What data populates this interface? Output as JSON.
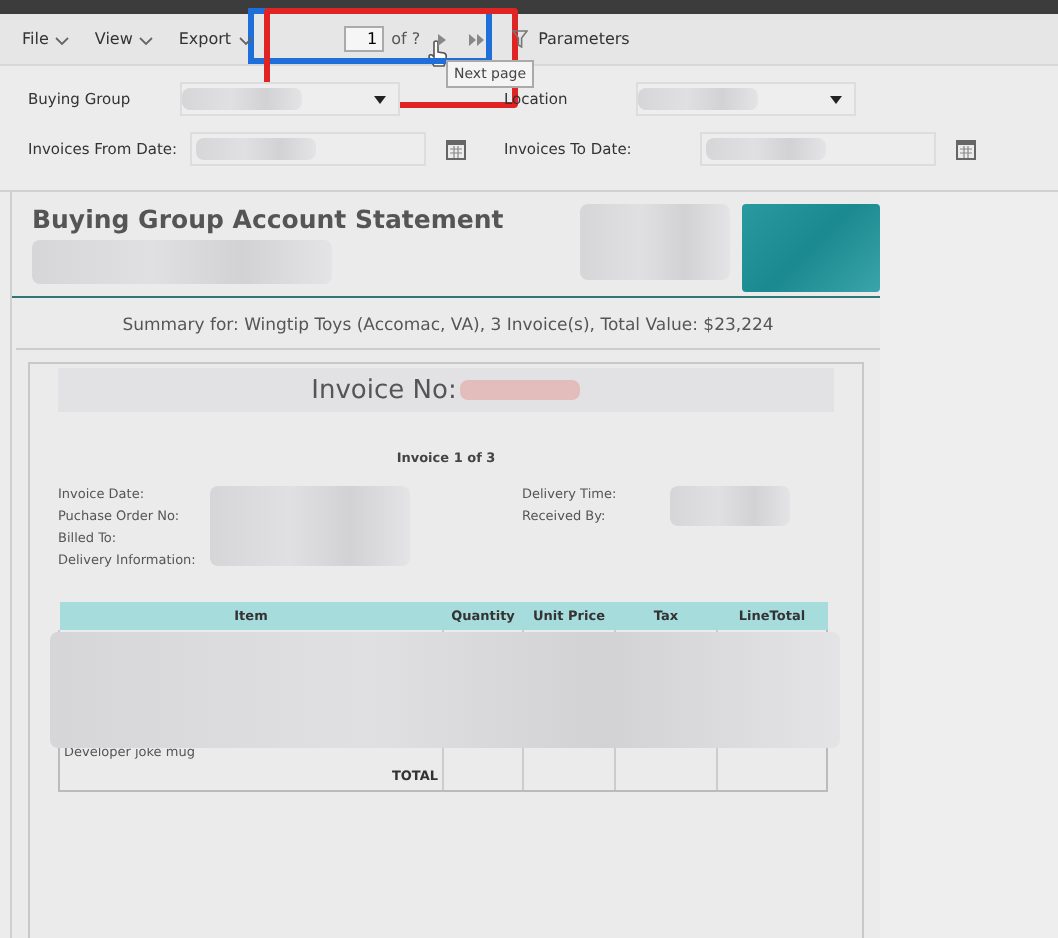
{
  "toolbar": {
    "menus": [
      {
        "label": "File"
      },
      {
        "label": "View"
      },
      {
        "label": "Export"
      }
    ],
    "page_input": {
      "value": "1"
    },
    "page_count": "of ?",
    "tooltip": "Next page",
    "parameters_label": "Parameters"
  },
  "parameters": [
    {
      "label": "Buying Group",
      "kind": "dropdown"
    },
    {
      "label": "Location",
      "kind": "dropdown"
    },
    {
      "label": "Invoices From Date:",
      "kind": "date"
    },
    {
      "label": "Invoices To Date:",
      "kind": "date"
    }
  ],
  "report": {
    "title": "Buying Group Account Statement",
    "summary": "Summary for: Wingtip Toys (Accomac, VA), 3 Invoice(s),  Total Value: $23,224",
    "invoice": {
      "heading": "Invoice No:",
      "subtitle": "Invoice 1 of 3",
      "details_left": [
        "Invoice Date:",
        "Puchase Order No:",
        "Billed To:",
        "Delivery Information:"
      ],
      "details_right": [
        "Delivery Time:",
        "Received By:"
      ],
      "columns": [
        "Item",
        "Quantity",
        "Unit Price",
        "Tax",
        "LineTotal"
      ],
      "last_item": "Developer joke mug",
      "total_label": "TOTAL"
    }
  },
  "highlights": [
    {
      "color": "#1e6fd9"
    },
    {
      "color": "#e02424"
    }
  ]
}
